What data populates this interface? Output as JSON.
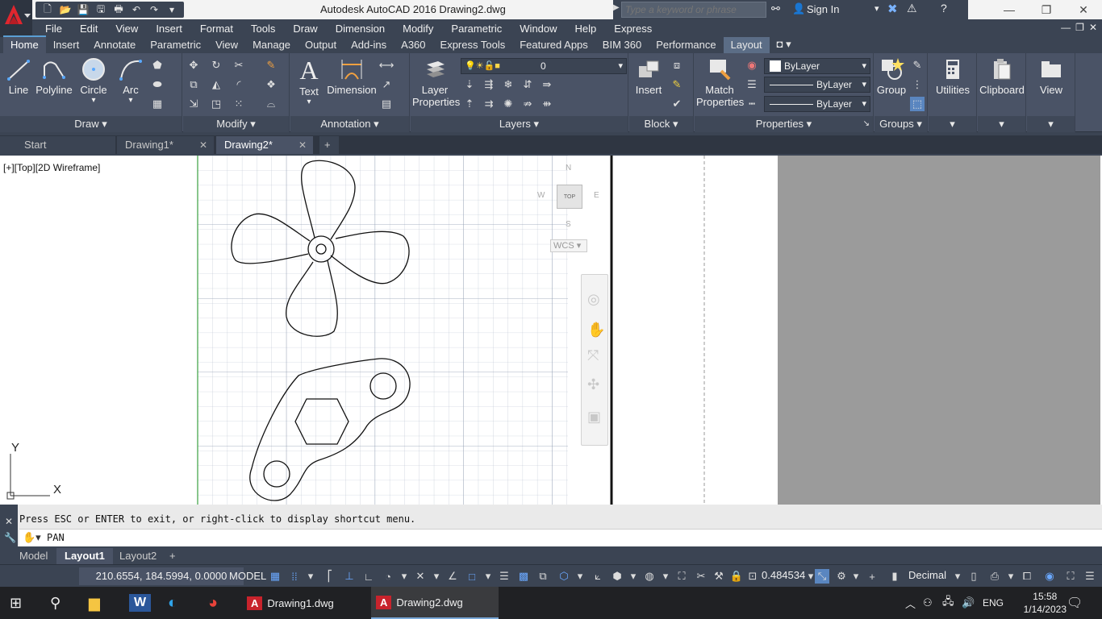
{
  "window": {
    "title": "Autodesk AutoCAD 2016    Drawing2.dwg",
    "search_placeholder": "Type a keyword or phrase",
    "sign_in": "Sign In"
  },
  "menu": [
    "File",
    "Edit",
    "View",
    "Insert",
    "Format",
    "Tools",
    "Draw",
    "Dimension",
    "Modify",
    "Parametric",
    "Window",
    "Help",
    "Express"
  ],
  "ribbon_tabs": [
    "Home",
    "Insert",
    "Annotate",
    "Parametric",
    "View",
    "Manage",
    "Output",
    "Add-ins",
    "A360",
    "Express Tools",
    "Featured Apps",
    "BIM 360",
    "Performance",
    "Layout"
  ],
  "ribbon": {
    "draw": {
      "title": "Draw",
      "line": "Line",
      "polyline": "Polyline",
      "circle": "Circle",
      "arc": "Arc"
    },
    "modify": {
      "title": "Modify"
    },
    "annotation": {
      "title": "Annotation",
      "text": "Text",
      "dimension": "Dimension"
    },
    "layers": {
      "title": "Layers",
      "layer_properties_1": "Layer",
      "layer_properties_2": "Properties",
      "current_layer": "0"
    },
    "block": {
      "title": "Block",
      "insert": "Insert"
    },
    "properties": {
      "title": "Properties",
      "match_1": "Match",
      "match_2": "Properties",
      "color": "ByLayer",
      "linetype": "ByLayer",
      "lineweight": "ByLayer"
    },
    "groups": {
      "title": "Groups",
      "group": "Group"
    },
    "utilities": "Utilities",
    "clipboard": "Clipboard",
    "view": "View"
  },
  "doc_tabs": [
    {
      "label": "Start"
    },
    {
      "label": "Drawing1*"
    },
    {
      "label": "Drawing2*"
    }
  ],
  "viewport": {
    "label": "[+][Top][2D Wireframe]",
    "viewcube_top": "TOP",
    "compass_n": "N",
    "compass_s": "S",
    "compass_w": "W",
    "compass_e": "E",
    "ucs_label": "WCS",
    "axis_x": "X",
    "axis_y": "Y"
  },
  "command": {
    "history": "Press ESC or ENTER to exit, or right-click to display shortcut menu.",
    "input": "PAN"
  },
  "layout_tabs": [
    "Model",
    "Layout1",
    "Layout2"
  ],
  "status": {
    "coords": "210.6554, 184.5994, 0.0000",
    "model": "MODEL",
    "scale": "0.484534",
    "units": "Decimal"
  },
  "taskbar": {
    "apps": [
      "Drawing1.dwg",
      "Drawing2.dwg"
    ],
    "lang": "ENG",
    "time": "15:58",
    "date": "1/14/2023"
  }
}
